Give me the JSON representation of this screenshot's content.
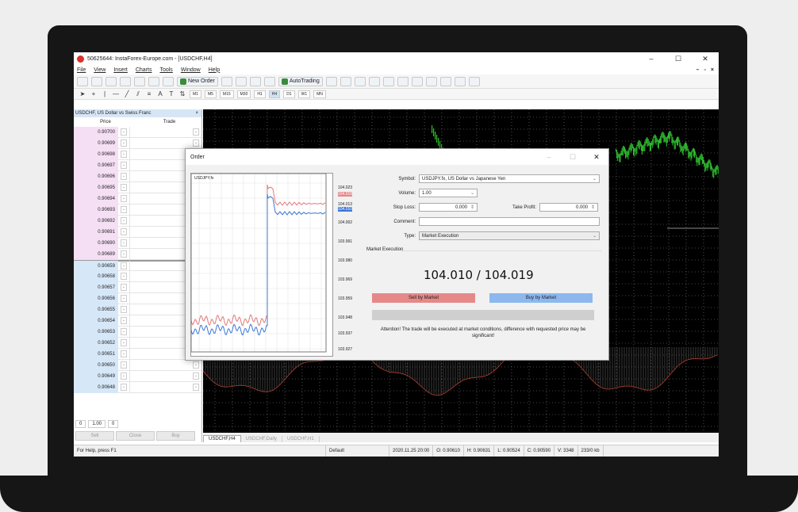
{
  "window": {
    "title": "50625644: InstaForex-Europe.com - [USDCHF,H4]",
    "minimize": "–",
    "maximize": "☐",
    "close": "✕"
  },
  "menu": [
    "File",
    "View",
    "Insert",
    "Charts",
    "Tools",
    "Window",
    "Help"
  ],
  "menu_right": [
    "–",
    "▫",
    "×"
  ],
  "toolbar": {
    "new_order": "New Order",
    "auto_trading": "AutoTrading"
  },
  "timeframes": [
    "M1",
    "M5",
    "M15",
    "M30",
    "H1",
    "H4",
    "D1",
    "W1",
    "MN"
  ],
  "active_timeframe": "H4",
  "dom": {
    "title": "USDCHF, US Dollar vs Swiss Franc",
    "close": "×",
    "col_price": "Price",
    "col_trade": "Trade",
    "ask_rows": [
      "0.90700",
      "0.90699",
      "0.90698",
      "0.90697",
      "0.90696",
      "0.90695",
      "0.90694",
      "0.90693",
      "0.90692",
      "0.90691",
      "0.90690",
      "0.90689"
    ],
    "bid_rows": [
      "0.90659",
      "0.90658",
      "0.90657",
      "0.90656",
      "0.90655",
      "0.90654",
      "0.90653",
      "0.90652",
      "0.90651",
      "0.90650",
      "0.90649",
      "0.90648"
    ],
    "sl_value": "0",
    "volume_value": "1.00",
    "tp_value": "0",
    "sell_label": "Sell",
    "close_label": "Close",
    "buy_label": "Buy"
  },
  "chart_tabs": [
    "USDCHF,H4",
    "USDCHF,Daily",
    "USDCHF,H1"
  ],
  "status": {
    "help": "For Help, press F1",
    "profile": "Default",
    "datetime": "2020.11.25 20:00",
    "open": "O: 0.90610",
    "high": "H: 0.90631",
    "low": "L: 0.90524",
    "close": "C: 0.90590",
    "volume": "V: 3348",
    "traffic": "233/0 kb"
  },
  "order": {
    "title": "Order",
    "mini_chart_title": "USDJPY.fx",
    "price_ticks": [
      "104.023",
      "104.018",
      "104.013",
      "104.010",
      "104.002",
      "103.991",
      "103.980",
      "103.969",
      "103.959",
      "103.948",
      "103.937",
      "103.927"
    ],
    "symbol_label": "Symbol:",
    "symbol_value": "USDJPY.fx, US Dollar vs Japanese Yen",
    "volume_label": "Volume:",
    "volume_value": "1.00",
    "sl_label": "Stop Loss:",
    "sl_value": "0.000",
    "tp_label": "Take Profit:",
    "tp_value": "0.000",
    "comment_label": "Comment:",
    "comment_value": "",
    "type_label": "Type:",
    "type_value": "Market Execution",
    "section": "Market Execution",
    "quote": "104.010 / 104.019",
    "sell_button": "Sell by Market",
    "buy_button": "Buy by Market",
    "warning": "Attention! The trade will be executed at market conditions, difference with requested price may be significant!"
  }
}
